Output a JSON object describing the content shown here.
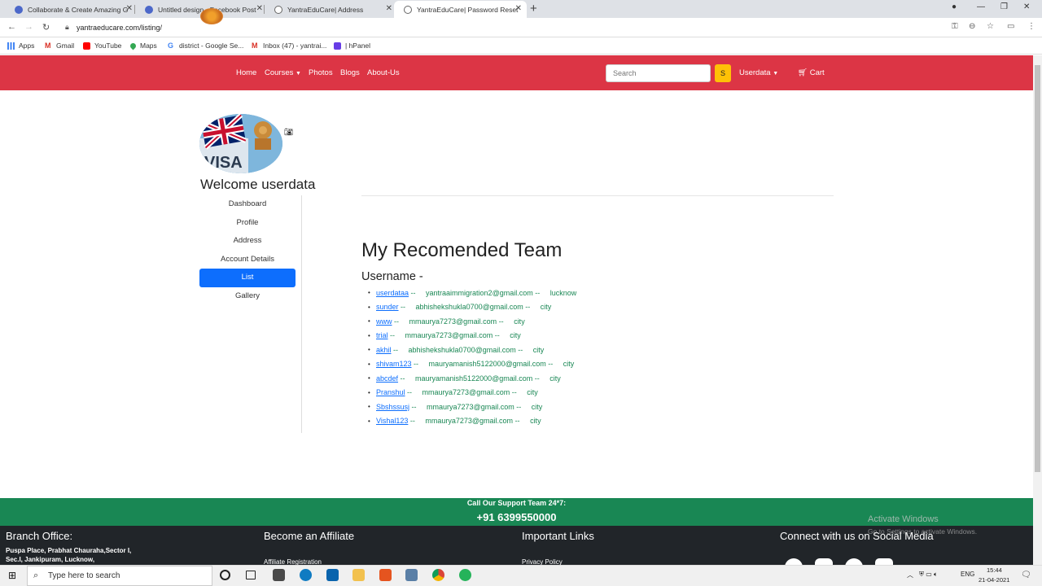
{
  "browser": {
    "tabs": [
      {
        "title": "Collaborate & Create Amazing G"
      },
      {
        "title": "Untitled design - Facebook Post"
      },
      {
        "title": "YantraEduCare| Address"
      },
      {
        "title": "YantraEduCare| Password Reset C"
      }
    ],
    "url": "yantraeducare.com/listing/",
    "bookmarks": [
      "Apps",
      "Gmail",
      "YouTube",
      "Maps",
      "district - Google Se...",
      "Inbox (47) - yantrai...",
      "| hPanel"
    ]
  },
  "site_nav": {
    "links": [
      "Home",
      "Courses",
      "Photos",
      "Blogs",
      "About-Us"
    ],
    "search_placeholder": "Search",
    "search_button": "S",
    "user_menu": "Userdata",
    "cart": "Cart"
  },
  "profile": {
    "welcome": "Welcome userdata",
    "menu": [
      "Dashboard",
      "Profile",
      "Address",
      "Account Details",
      "List",
      "Gallery"
    ],
    "active_item": "List"
  },
  "team": {
    "title": "My Recomended Team",
    "username_heading": "Username -",
    "members": [
      {
        "username": "userdataa",
        "email": "yantraaimmigration2@gmail.com",
        "city": "lucknow"
      },
      {
        "username": "sunder",
        "email": "abhishekshukla0700@gmail.com",
        "city": "city"
      },
      {
        "username": "www",
        "email": "mmaurya7273@gmail.com",
        "city": "city"
      },
      {
        "username": "trial",
        "email": "mmaurya7273@gmail.com",
        "city": "city"
      },
      {
        "username": "akhil",
        "email": "abhishekshukla0700@gmail.com",
        "city": "city"
      },
      {
        "username": "shivam123",
        "email": "mauryamanish5122000@gmail.com",
        "city": "city"
      },
      {
        "username": "abcdef",
        "email": "mauryamanish5122000@gmail.com",
        "city": "city"
      },
      {
        "username": "Pranshul",
        "email": "mmaurya7273@gmail.com",
        "city": "city"
      },
      {
        "username": "Sbshssusj",
        "email": "mmaurya7273@gmail.com",
        "city": "city"
      },
      {
        "username": "Vishal123",
        "email": "mmaurya7273@gmail.com",
        "city": "city"
      }
    ]
  },
  "footer": {
    "support_label": "Call Our Support Team 24*7:",
    "support_phone": "+91 6399550000",
    "branch_heading": "Branch Office:",
    "branch_line1": "Puspa Place, Prabhat Chauraha,Sector I,",
    "branch_line2": "Sec.I, Jankipuram, Lucknow,",
    "affiliate_heading": "Become an Affiliate",
    "affiliate_link": "Affiliate Registration",
    "links_heading": "Important Links",
    "links_first": "Privacy Policy",
    "social_heading": "Connect with us on Social Media"
  },
  "watermark": {
    "line1": "Activate Windows",
    "line2": "Go to Settings to activate Windows."
  },
  "taskbar": {
    "search_placeholder": "Type here to search",
    "lang": "ENG",
    "time": "15:44",
    "date": "21-04-2021"
  },
  "colors": {
    "nav_red": "#dc3545",
    "footer_green": "#198754",
    "footer_dark": "#212529",
    "active_blue": "#0d6efd",
    "search_yellow": "#ffc107"
  }
}
